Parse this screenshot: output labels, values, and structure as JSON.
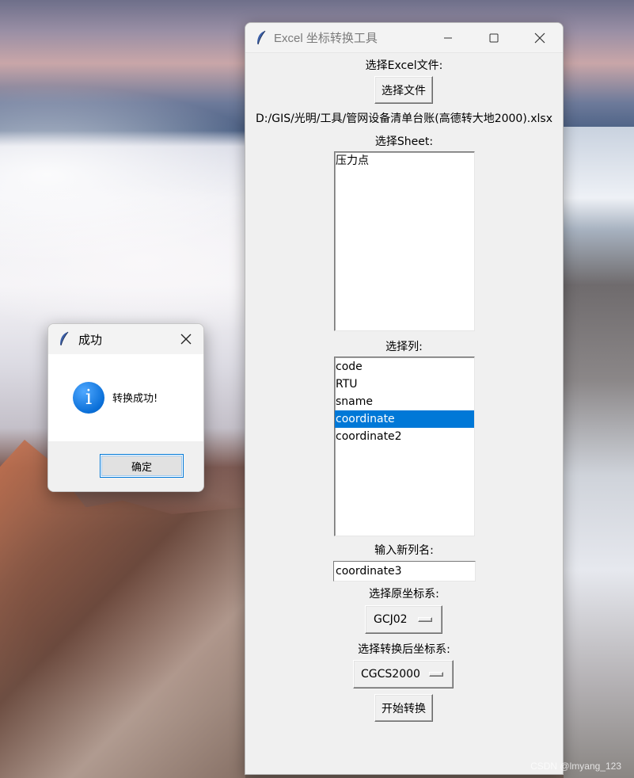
{
  "main_window": {
    "title": "Excel 坐标转换工具",
    "controls": {
      "minimize": "—",
      "maximize": "☐",
      "close": "✕"
    },
    "file_label": "选择Excel文件:",
    "file_button": "选择文件",
    "file_path": "D:/GIS/光明/工具/管网设备清单台账(高德转大地2000).xlsx",
    "sheet_label": "选择Sheet:",
    "sheets": [
      "压力点"
    ],
    "column_label": "选择列:",
    "columns": [
      "code",
      "RTU",
      "sname",
      "coordinate",
      "coordinate2"
    ],
    "selected_column": "coordinate",
    "new_col_label": "输入新列名:",
    "new_col_value": "coordinate3",
    "src_crs_label": "选择原坐标系:",
    "src_crs_value": "GCJ02",
    "dst_crs_label": "选择转换后坐标系:",
    "dst_crs_value": "CGCS2000",
    "start_button": "开始转换"
  },
  "dialog": {
    "title": "成功",
    "message": "转换成功!",
    "ok_label": "确定"
  },
  "watermark": "CSDN @lmyang_123",
  "colors": {
    "selection": "#0078d7",
    "window_bg": "#f0f0f0",
    "info_icon": "#0a6fd8"
  }
}
